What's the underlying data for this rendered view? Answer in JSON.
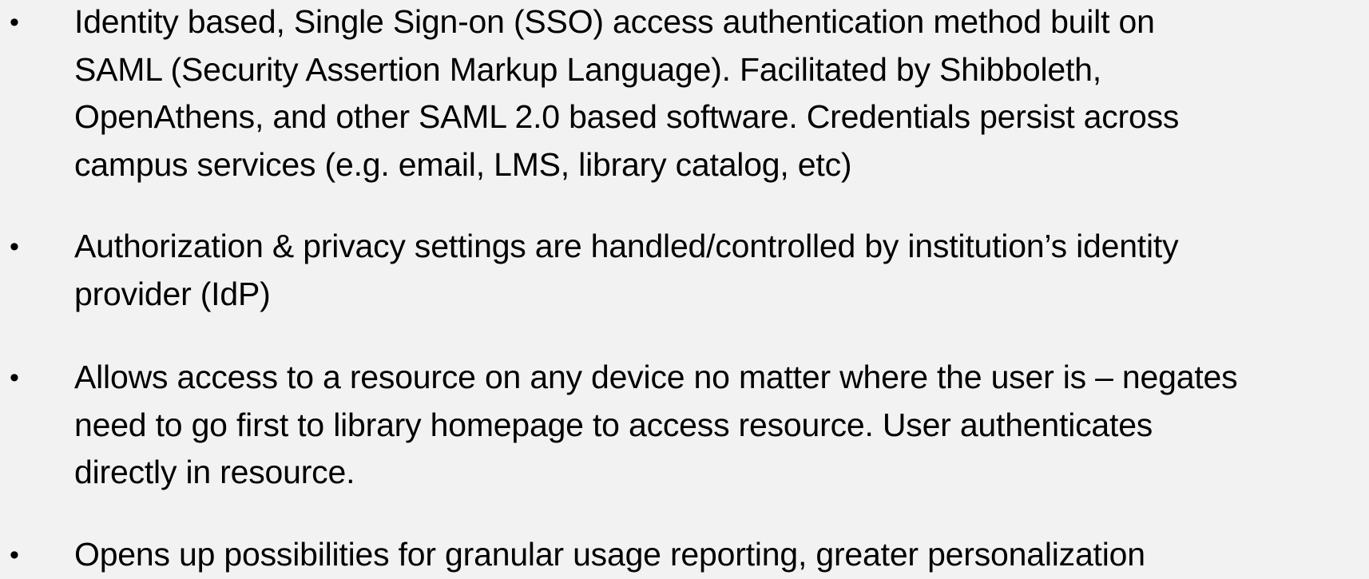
{
  "bullet_symbol": "•",
  "bullets": [
    {
      "lines": [
        "Identity based, Single Sign-on (SSO) access authentication method built on",
        "SAML (Security Assertion Markup Language). Facilitated by Shibboleth,",
        "OpenAthens, and other SAML 2.0 based software. Credentials persist across",
        "campus services (e.g. email, LMS, library catalog, etc)"
      ]
    },
    {
      "lines": [
        "Authorization & privacy settings are handled/controlled by institution’s identity",
        "provider (IdP)"
      ]
    },
    {
      "lines": [
        "Allows access to a resource on any device no matter where the user is – negates",
        "need to go first to library homepage to access resource. User authenticates",
        "directly in resource."
      ]
    },
    {
      "lines": [
        "Opens up possibilities for granular usage reporting, greater personalization"
      ]
    }
  ]
}
